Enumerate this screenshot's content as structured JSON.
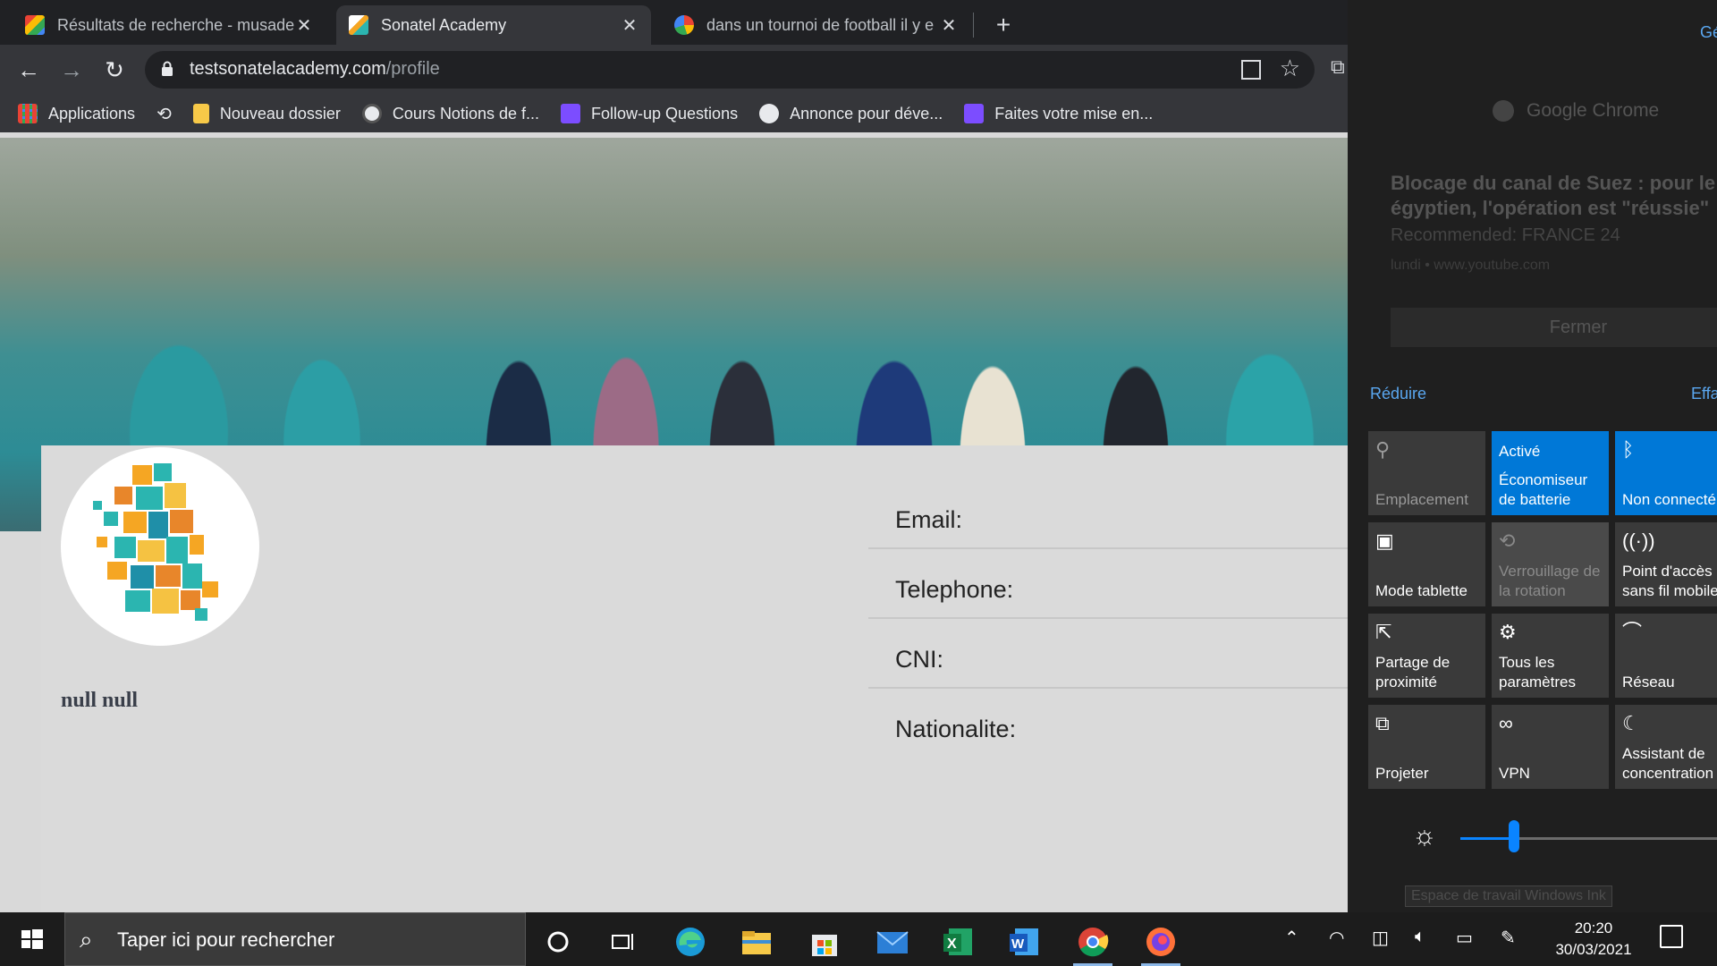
{
  "browser": {
    "tabs": [
      {
        "title": "Résultats de recherche - musade",
        "favicon": "gmail-icon",
        "active": false
      },
      {
        "title": "Sonatel Academy",
        "favicon": "sonatel-icon",
        "active": true
      },
      {
        "title": "dans un tournoi de football il y e",
        "favicon": "google-icon",
        "active": false
      }
    ],
    "url_host": "testsonatelacademy.com",
    "url_path": "/profile",
    "bookmarks": [
      {
        "label": "Applications",
        "icon": "apps-grid-icon"
      },
      {
        "label": "",
        "icon": "history-icon"
      },
      {
        "label": "Nouveau dossier",
        "icon": "folder-icon"
      },
      {
        "label": "Cours Notions de f...",
        "icon": "site-icon"
      },
      {
        "label": "Follow-up Questions",
        "icon": "follow-up-icon"
      },
      {
        "label": "Annonce pour déve...",
        "icon": "globe-icon"
      },
      {
        "label": "Faites votre mise en...",
        "icon": "follow-up-icon"
      }
    ]
  },
  "profile": {
    "name": "null null",
    "fields": [
      {
        "label": "Email:"
      },
      {
        "label": "Telephone:"
      },
      {
        "label": "CNI:"
      },
      {
        "label": "Nationalite:"
      }
    ]
  },
  "action_center": {
    "top_right_link": "Gé",
    "notification": {
      "app": "Google Chrome",
      "title_line1": "Blocage du canal de Suez : pour le p",
      "title_line2": "égyptien, l'opération est \"réussie\"",
      "recommended": "Recommended: FRANCE 24",
      "source": "lundi • www.youtube.com",
      "close_label": "Fermer"
    },
    "collapse_label": "Réduire",
    "clear_label": "Effa",
    "tiles": [
      {
        "label": "Emplacement",
        "icon": "location-icon",
        "state": "dim"
      },
      {
        "label_top": "Activé",
        "label": "Économiseur de batterie",
        "icon": "battery-saver-icon",
        "state": "on"
      },
      {
        "label": "Non connecté",
        "icon": "bluetooth-icon",
        "state": "on"
      },
      {
        "label": "Mode tablette",
        "icon": "tablet-mode-icon",
        "state": "off"
      },
      {
        "label": "Verrouillage de la rotation",
        "icon": "rotation-lock-icon",
        "state": "disabled"
      },
      {
        "label": "Point d'accès sans fil mobile",
        "icon": "hotspot-icon",
        "state": "off"
      },
      {
        "label": "Partage de proximité",
        "icon": "nearby-share-icon",
        "state": "off"
      },
      {
        "label": "Tous les paramètres",
        "icon": "settings-icon",
        "state": "off"
      },
      {
        "label": "Réseau",
        "icon": "network-icon",
        "state": "off"
      },
      {
        "label": "Projeter",
        "icon": "project-icon",
        "state": "off"
      },
      {
        "label": "VPN",
        "icon": "vpn-icon",
        "state": "off"
      },
      {
        "label": "Assistant de concentration",
        "icon": "focus-assist-icon",
        "state": "off"
      }
    ],
    "brightness": 0.2,
    "ink_tooltip": "Espace de travail Windows Ink"
  },
  "taskbar": {
    "search_placeholder": "Taper ici pour rechercher",
    "apps": [
      "cortana-icon",
      "task-view-icon",
      "edge-icon",
      "file-explorer-icon",
      "store-icon",
      "mail-icon",
      "excel-icon",
      "word-icon",
      "chrome-icon",
      "firefox-icon"
    ],
    "time": "20:20",
    "date": "30/03/2021"
  },
  "colors": {
    "accent": "#0078d7",
    "link": "#5aa7f0",
    "page_bg": "#d9d9d9"
  }
}
